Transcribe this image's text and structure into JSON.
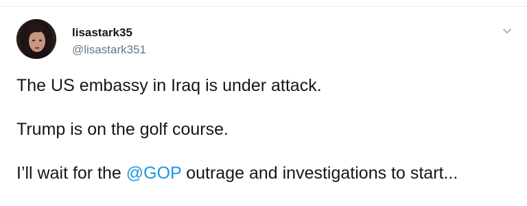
{
  "user": {
    "display_name": "lisastark35",
    "handle": "@lisastark351"
  },
  "tweet": {
    "line1": "The US embassy in Iraq is under attack.",
    "line2": "Trump is on the golf course.",
    "line3_before": "I’ll wait for the ",
    "line3_mention": "@GOP",
    "line3_after": " outrage and investigations to start..."
  },
  "icons": {
    "menu": "chevron-down-icon",
    "avatar": "profile-photo"
  },
  "colors": {
    "text": "#14171a",
    "secondary": "#657786",
    "link": "#1b95e0",
    "divider": "#e6ecf0"
  }
}
